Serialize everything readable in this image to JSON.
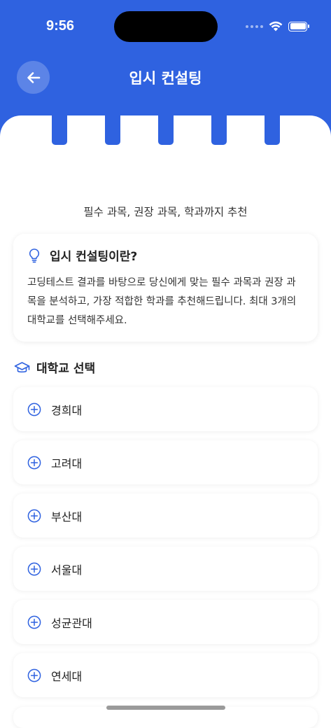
{
  "status_bar": {
    "time": "9:56"
  },
  "header": {
    "title": "입시 컨설팅"
  },
  "subtitle": "필수 과목, 권장 과목, 학과까지 추천",
  "info_card": {
    "title": "입시 컨설팅이란?",
    "body": "고딩테스트 결과를 바탕으로 당신에게 맞는 필수 과목과 권장 과목을 분석하고, 가장 적합한 학과를 추천해드립니다. 최대 3개의 대학교를 선택해주세요."
  },
  "section": {
    "title": "대학교 선택"
  },
  "universities": [
    "경희대",
    "고려대",
    "부산대",
    "서울대",
    "성균관대",
    "연세대"
  ],
  "colors": {
    "primary": "#2f62e0"
  },
  "icons": {
    "back": "arrow-left-icon",
    "info": "lightbulb-icon",
    "section": "graduation-cap-icon",
    "add": "plus-circle-icon"
  }
}
